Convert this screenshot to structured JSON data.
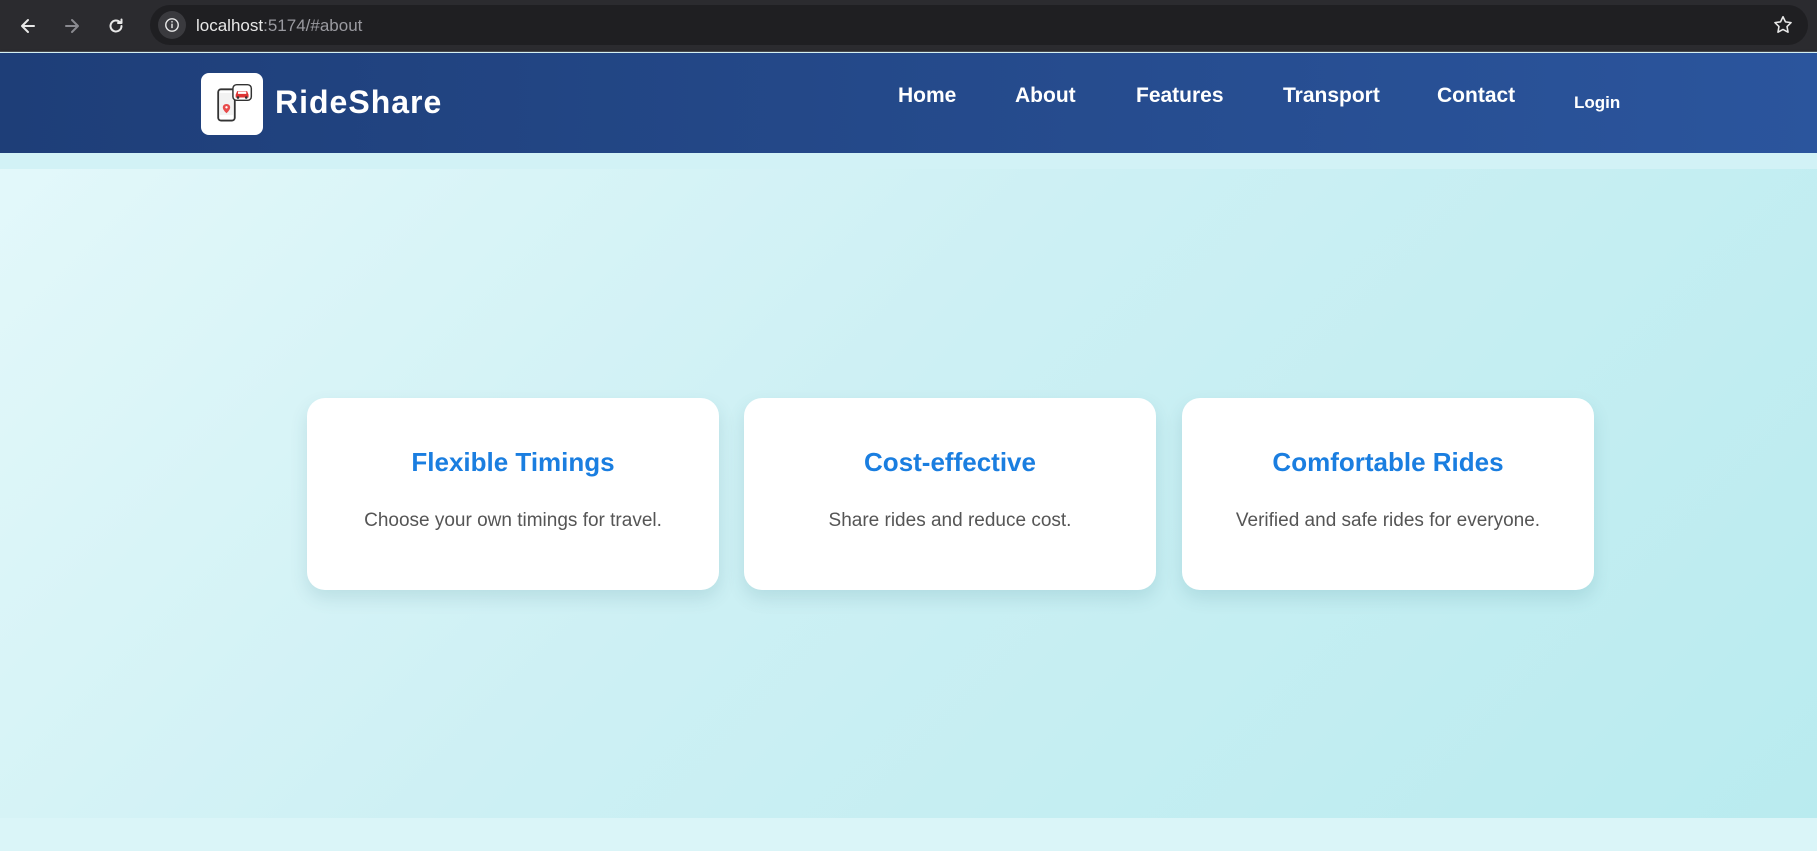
{
  "browser": {
    "url_host": "localhost",
    "url_rest": ":5174/#about"
  },
  "header": {
    "brand": "RideShare",
    "nav": {
      "home": "Home",
      "about": "About",
      "features": "Features",
      "transport": "Transport",
      "contact": "Contact"
    },
    "login": "Login"
  },
  "cards": [
    {
      "title": "Flexible Timings",
      "description": "Choose your own timings for travel."
    },
    {
      "title": "Cost-effective",
      "description": "Share rides and reduce cost."
    },
    {
      "title": "Comfortable Rides",
      "description": "Verified and safe rides for everyone."
    }
  ],
  "colors": {
    "header_start": "#1e3e78",
    "header_end": "#2b559d",
    "card_title": "#1a7ee0",
    "background": "#cdf0f4"
  }
}
